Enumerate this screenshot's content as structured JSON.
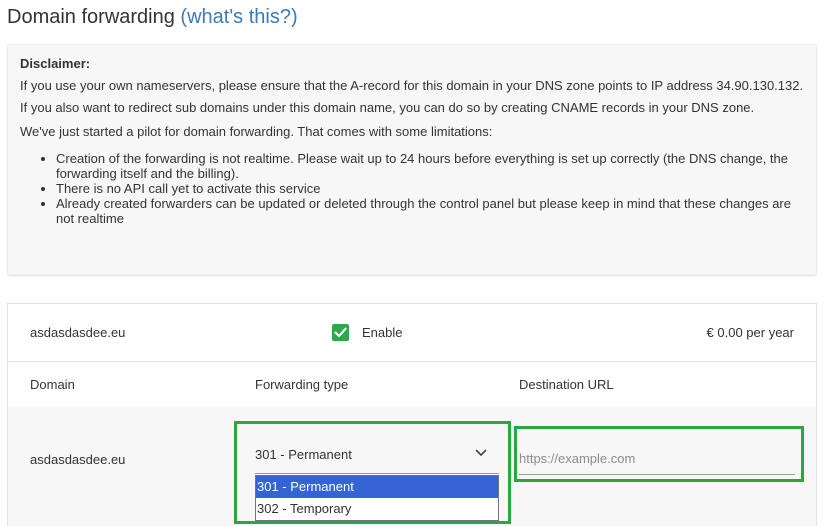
{
  "header": {
    "title": "Domain forwarding",
    "help_link": "(what's this?)"
  },
  "disclaimer": {
    "heading": "Disclaimer:",
    "paragraph1": "If you use your own nameservers, please ensure that the A-record for this domain in your DNS zone points to IP address 34.90.130.132. If you also want to redirect sub domains under this domain name, you can do so by creating CNAME records in your DNS zone.",
    "paragraph2": "We've just started a pilot for domain forwarding. That comes with some limitations:",
    "limitations": [
      "Creation of the forwarding is not realtime. Please wait up to 24 hours before everything is set up correctly (the DNS change, the forwarding itself and the billing).",
      "There is no API call yet to activate this service",
      "Already created forwarders can be updated or deleted through the control panel but please keep in mind that these changes are not realtime"
    ]
  },
  "forwarding": {
    "domain": "asdasdasdee.eu",
    "enable_label": "Enable",
    "enabled": true,
    "price": "€ 0.00 per year",
    "columns": {
      "domain": "Domain",
      "type": "Forwarding type",
      "url": "Destination URL"
    },
    "row": {
      "domain": "asdasdasdee.eu",
      "selected_type": "301 - Permanent",
      "type_options": [
        "301 - Permanent",
        "302 - Temporary"
      ],
      "url_placeholder": "https://example.com"
    }
  },
  "colors": {
    "link": "#3d7ab8",
    "checkbox": "#2ea84b",
    "highlight": "#28a745",
    "option_selected": "#3463d3"
  }
}
